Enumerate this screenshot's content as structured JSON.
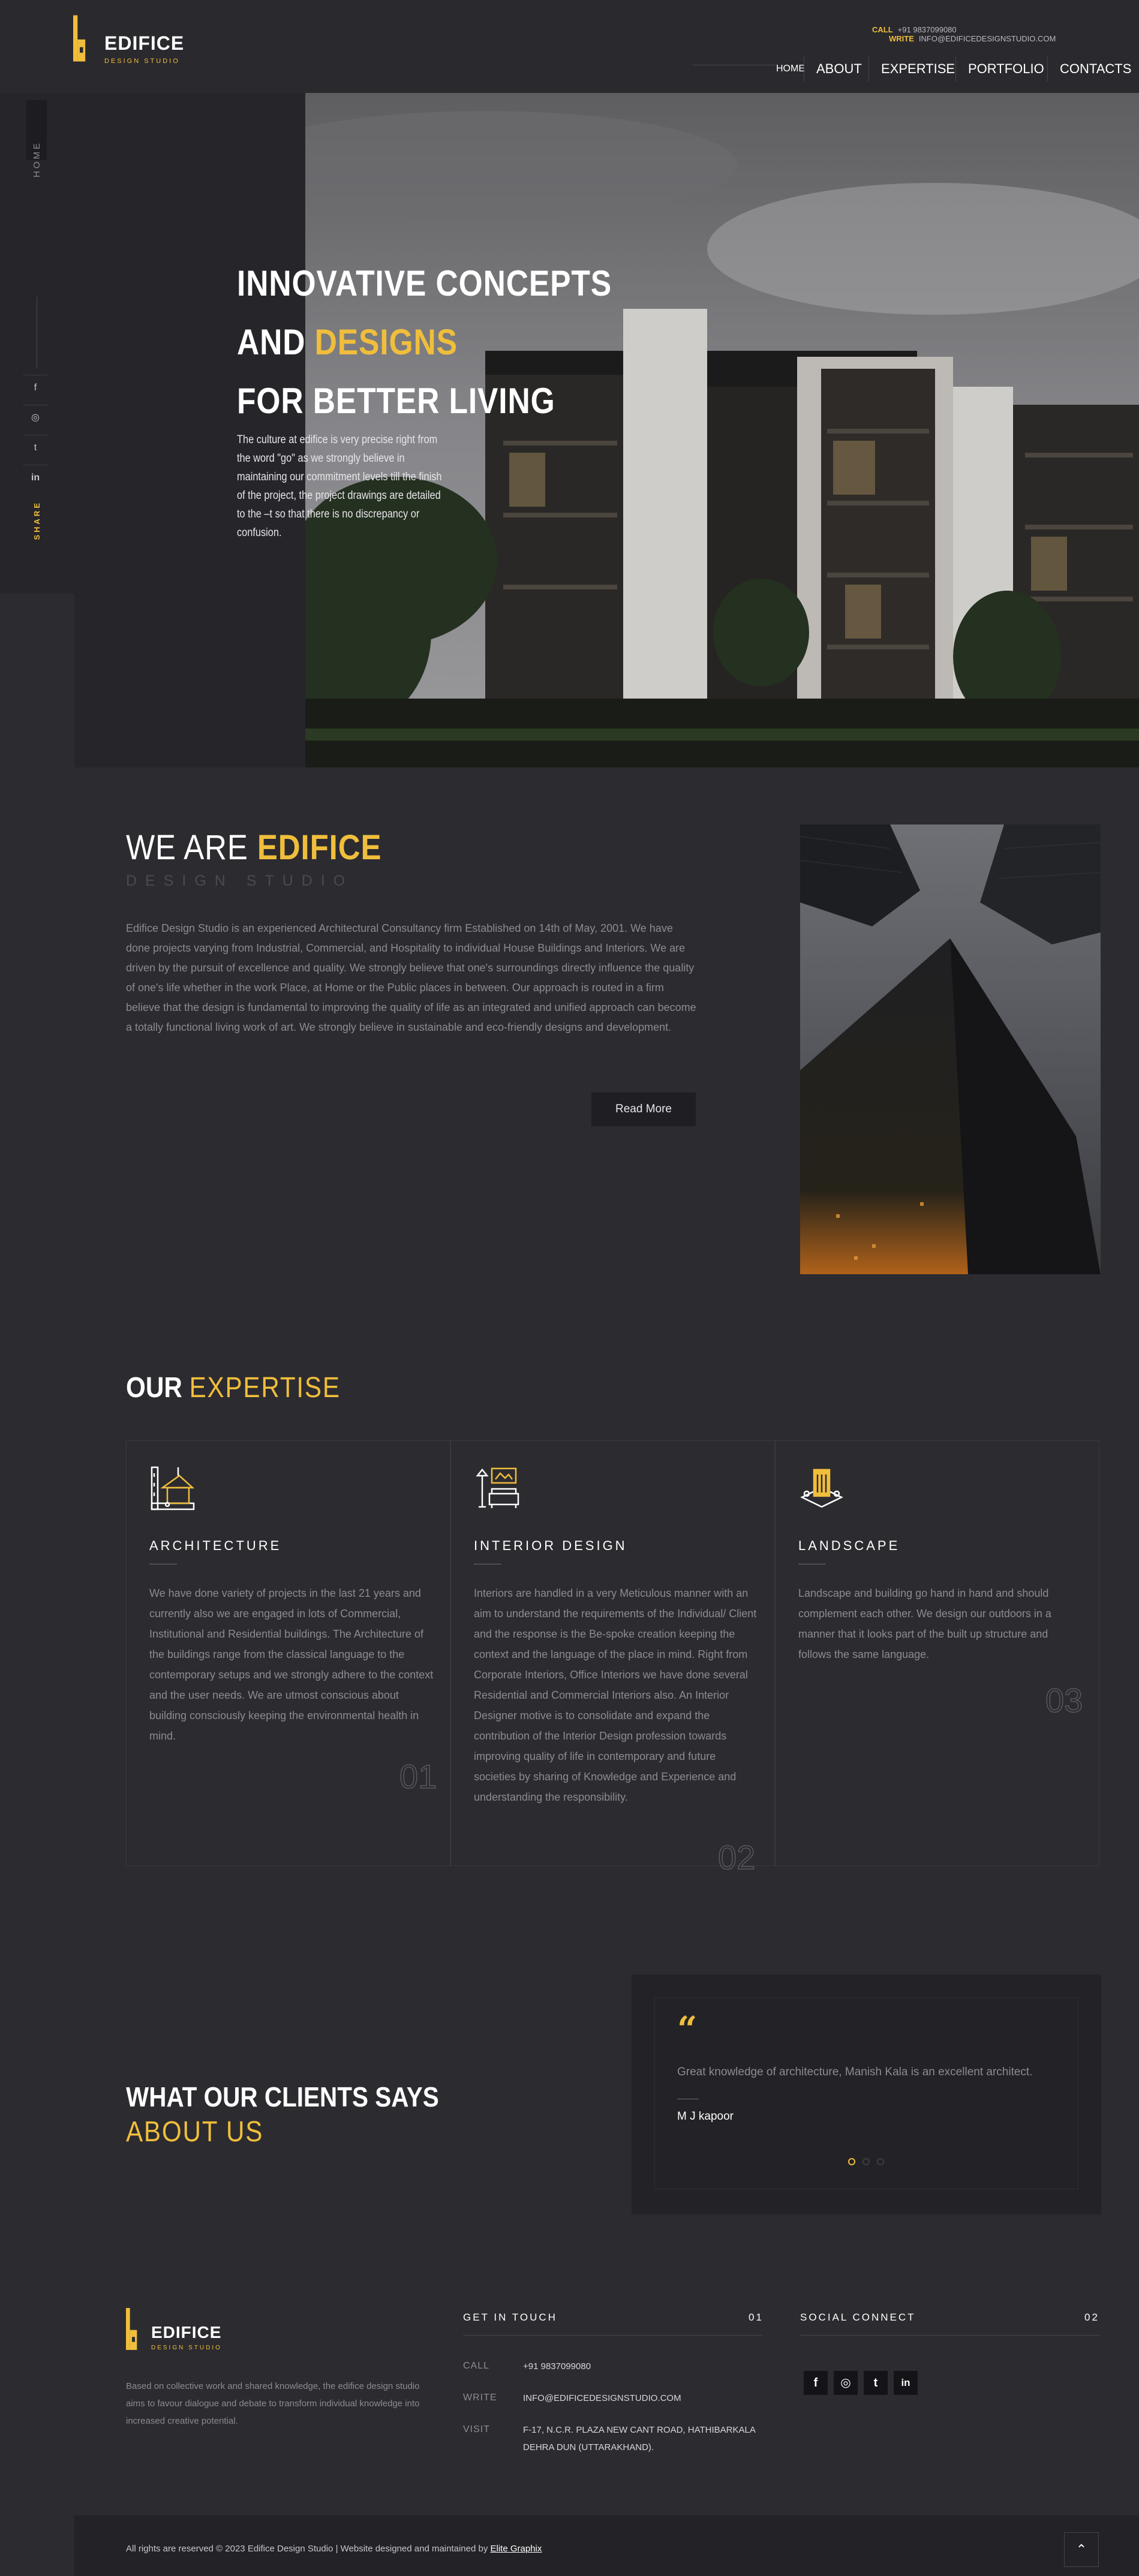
{
  "brand": {
    "name": "EDIFICE",
    "tagline": "DESIGN STUDIO"
  },
  "topbar": {
    "call_label": "CALL",
    "call_value": "+91 9837099080",
    "write_label": "WRITE",
    "write_value": "INFO@EDIFICEDESIGNSTUDIO.COM"
  },
  "nav": {
    "items": [
      "HOME",
      "ABOUT",
      "EXPERTISE",
      "PORTFOLIO",
      "CONTACTS"
    ],
    "active": "HOME"
  },
  "sidebar": {
    "home_label": "HOME",
    "share_label": "SHARE",
    "social_icons": [
      "facebook-icon",
      "instagram-icon",
      "twitter-icon",
      "linkedin-icon"
    ],
    "social_glyphs": [
      "f",
      "◎",
      "t",
      "in"
    ]
  },
  "hero": {
    "line1": "INNOVATIVE CONCEPTS",
    "line2_a": "AND ",
    "line2_b": "DESIGNS",
    "line3": "FOR BETTER LIVING",
    "desc": "The culture at edifice is very precise right from the word \"go\" as we strongly believe in maintaining our commitment levels till the finish of the project, the project drawings are detailed to the –t so that there is no discrepancy or confusion."
  },
  "about": {
    "title_a": "WE ARE ",
    "title_b": "EDIFICE",
    "subtitle": "DESIGN STUDIO",
    "body": "Edifice Design Studio is an experienced Architectural Consultancy firm Established on 14th of May, 2001. We have done projects varying from Industrial, Commercial, and Hospitality to individual House Buildings and Interiors. We are driven by the pursuit of excellence and quality. We strongly believe that one's surroundings directly influence the quality of one's life whether in the work Place, at Home or the Public places in between. Our approach is routed in a firm believe that the design is fundamental to improving the quality of life as an integrated and unified approach can become a totally functional living work of art. We strongly believe in sustainable and eco-friendly designs and development.",
    "button": "Read More"
  },
  "expertise": {
    "title_a": "OUR ",
    "title_b": "EXPERTISE",
    "cards": [
      {
        "title": "ARCHITECTURE",
        "num": "01",
        "icon": "architecture-icon",
        "text": "We have done variety of projects in the last 21 years and currently also we are engaged in lots of Commercial, Institutional and Residential buildings. The Architecture of the buildings range from the classical language to the contemporary setups and we strongly adhere to the context and the user needs. We are utmost conscious about building consciously keeping the environmental health in mind."
      },
      {
        "title": "INTERIOR DESIGN",
        "num": "02",
        "icon": "interior-design-icon",
        "text": "Interiors are handled in a very Meticulous manner with an aim to understand the requirements of the Individual/ Client and the response is the Be-spoke creation keeping the context and the language of the place in mind. Right from Corporate Interiors, Office Interiors we have done several Residential and Commercial Interiors also. An Interior Designer motive is to consolidate and expand the contribution of the Interior Design profession towards improving quality of life in contemporary and future societies by sharing of Knowledge and Experience and understanding the responsibility."
      },
      {
        "title": "LANDSCAPE",
        "num": "03",
        "icon": "landscape-icon",
        "text": "Landscape and building go hand in hand and should complement each other. We design our outdoors in a manner that it looks part of the built up structure and follows the same language."
      }
    ]
  },
  "clients": {
    "title_a": "WHAT OUR CLIENTS SAYS",
    "title_b": "ABOUT US",
    "quote": "Great knowledge of architecture, Manish Kala is an excellent architect.",
    "author": "M J kapoor"
  },
  "footer": {
    "about": "Based on collective work and shared knowledge, the edifice design studio aims to favour dialogue and debate to transform individual knowledge into increased creative potential.",
    "contact_title": "GET IN TOUCH",
    "contact_num": "01",
    "social_title": "SOCIAL CONNECT",
    "social_num": "02",
    "call_label": "CALL",
    "call_value": "+91 9837099080",
    "write_label": "WRITE",
    "write_value": "INFO@EDIFICEDESIGNSTUDIO.COM",
    "visit_label": "VISIT",
    "visit_line1": "F-17, N.C.R. PLAZA NEW CANT ROAD, HATHIBARKALA",
    "visit_line2": "DEHRA DUN (UTTARAKHAND).",
    "copyright": "All rights are reserved © 2023 Edifice Design Studio | Website designed and maintained by ",
    "credit": "Elite Graphix"
  },
  "colors": {
    "accent": "#f0be3c",
    "bg": "#2c2b30",
    "panel": "#26252a"
  }
}
